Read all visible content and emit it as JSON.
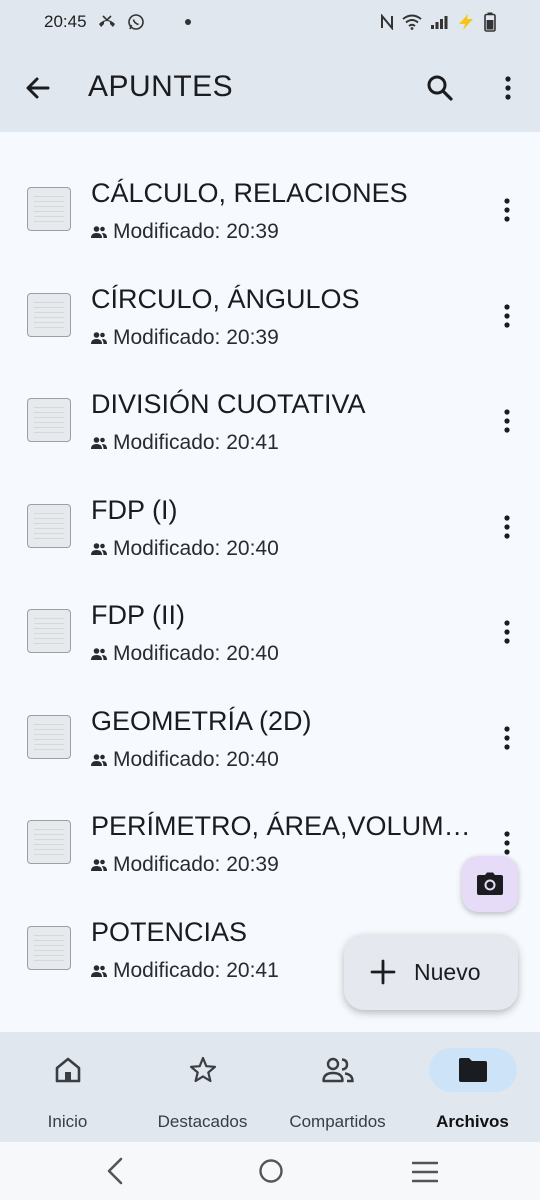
{
  "status_bar": {
    "time": "20:45",
    "icons": [
      "missed-call-icon",
      "whatsapp-icon",
      "notification-dot-icon",
      "nfc-icon",
      "wifi-icon",
      "signal-icon",
      "charging-icon",
      "battery-icon"
    ]
  },
  "app_bar": {
    "title": "APUNTES",
    "back_icon": "arrow-back-icon",
    "search_icon": "search-icon",
    "more_icon": "more-vert-icon"
  },
  "files": [
    {
      "name": "CÁLCULO, RELACIONES",
      "meta": "Modificado: 20:39"
    },
    {
      "name": "CÍRCULO, ÁNGULOS",
      "meta": "Modificado: 20:39"
    },
    {
      "name": "DIVISIÓN CUOTATIVA",
      "meta": "Modificado: 20:41"
    },
    {
      "name": "FDP (I)",
      "meta": "Modificado: 20:40"
    },
    {
      "name": "FDP (II)",
      "meta": "Modificado: 20:40"
    },
    {
      "name": "GEOMETRÍA (2D)",
      "meta": "Modificado: 20:40"
    },
    {
      "name": "PERÍMETRO, ÁREA,VOLUME…",
      "meta": "Modificado: 20:39"
    },
    {
      "name": "POTENCIAS",
      "meta": "Modificado: 20:41"
    }
  ],
  "fab": {
    "camera_icon": "camera-icon",
    "new_label": "Nuevo",
    "new_icon": "plus-icon"
  },
  "bottom_nav": {
    "items": [
      {
        "label": "Inicio",
        "icon": "home-icon",
        "active": false
      },
      {
        "label": "Destacados",
        "icon": "star-icon",
        "active": false
      },
      {
        "label": "Compartidos",
        "icon": "people-icon",
        "active": false
      },
      {
        "label": "Archivos",
        "icon": "folder-icon",
        "active": true
      }
    ]
  },
  "system_nav": {
    "icons": [
      "system-back-icon",
      "system-home-icon",
      "system-recents-icon"
    ]
  },
  "colors": {
    "app_bar_bg": "#e1e7ee",
    "list_bg": "#f6f9fd",
    "active_nav_pill": "#cde3f8",
    "camera_fab_bg": "#e6dcf8",
    "charging_bolt": "#f5c518"
  }
}
